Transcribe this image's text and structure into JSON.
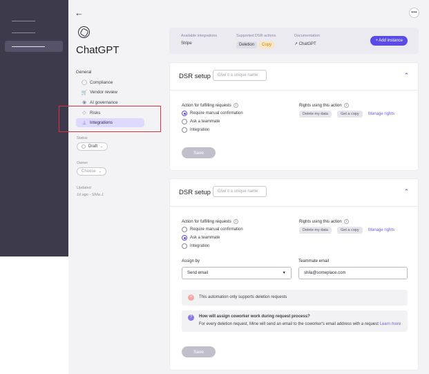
{
  "app": {
    "title": "ChatGPT"
  },
  "nav": {
    "general": "General",
    "items": [
      {
        "label": "Compliance",
        "icon": "check-circle-icon"
      },
      {
        "label": "Vendor review",
        "icon": "cart-icon"
      },
      {
        "label": "AI governance",
        "icon": "eye-icon"
      },
      {
        "label": "Risks",
        "icon": "shield-icon"
      },
      {
        "label": "Integrations",
        "icon": "plug-icon"
      }
    ]
  },
  "meta": {
    "status_label": "Status",
    "status_value": "Draft",
    "owner_label": "Owner",
    "owner_value": "Choose",
    "updated_label": "Updated",
    "updated_value": "1d ago - Shila J."
  },
  "info": {
    "available_label": "Available integrations",
    "available_value": "Stripe",
    "supported_label": "Supported DSR actions",
    "tag_deletion": "Deletion",
    "tag_copy": "Copy",
    "doc_label": "Documentation",
    "doc_link": "ChatGPT",
    "add_button": "+ Add instance"
  },
  "cards": [
    {
      "header": "DSR setup",
      "name_placeholder": "Give it a unique name",
      "action_label": "Action for fulfilling requests",
      "options": [
        "Require manual confirmation",
        "Ask a teammate",
        "Integration"
      ],
      "rights_label": "Rights using this action",
      "chip1": "Delete my data",
      "chip2": "Get a copy",
      "manage": "Manage rights",
      "save": "Save"
    },
    {
      "header": "DSR setup",
      "name_placeholder": "Give it a unique name",
      "action_label": "Action for fulfilling requests",
      "options": [
        "Require manual confirmation",
        "Ask a teammate",
        "Integration"
      ],
      "rights_label": "Rights using this action",
      "chip1": "Delete my data",
      "chip2": "Get a copy",
      "manage": "Manage rights",
      "assign_label": "Assign by",
      "assign_value": "Send email",
      "email_label": "Teammate email",
      "email_value": "shila@someplace.com",
      "note1": "This automation only supports deletion requests",
      "note2_title": "How will assign coworker work during request process?",
      "note2_body": "For every deletion request, Mine will send an email to the coworker's email address with a request",
      "note2_link": "Learn more",
      "save": "Save"
    }
  ]
}
